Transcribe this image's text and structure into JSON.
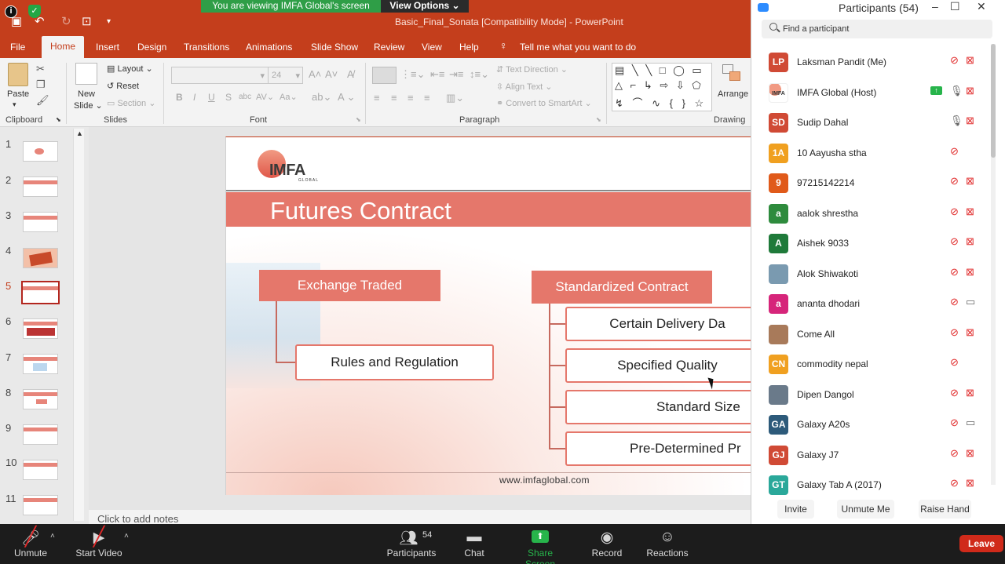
{
  "zoom": {
    "viewing_banner": "You are viewing IMFA Global's screen",
    "view_options": "View Options ⌄"
  },
  "powerpoint": {
    "doc_title": "Basic_Final_Sonata [Compatibility Mode]  -  PowerPoint",
    "tabs": [
      "File",
      "Home",
      "Insert",
      "Design",
      "Transitions",
      "Animations",
      "Slide Show",
      "Review",
      "View",
      "Help"
    ],
    "tell_me": "Tell me what you want to do",
    "ribbon": {
      "clipboard": {
        "label": "Clipboard",
        "paste": "Paste"
      },
      "slides": {
        "label": "Slides",
        "new_slide": "New",
        "new_slide2": "Slide ⌄",
        "layout": "Layout ⌄",
        "reset": "Reset",
        "section": "Section ⌄"
      },
      "font": {
        "label": "Font",
        "size": "24"
      },
      "paragraph": {
        "label": "Paragraph",
        "text_direction": "Text Direction ⌄",
        "align_text": "Align Text ⌄",
        "convert": "Convert to SmartArt ⌄"
      },
      "drawing": {
        "label": "Drawing",
        "arrange": "Arrange"
      }
    },
    "thumbnails": [
      "1",
      "2",
      "3",
      "4",
      "5",
      "6",
      "7",
      "8",
      "9",
      "10",
      "11"
    ],
    "selected_slide": "5",
    "notes_placeholder": "Click to add notes",
    "slide": {
      "logo": "IMFA",
      "logo_sub": "GLOBAL",
      "title": "Futures Contract",
      "left_header": "Exchange Traded",
      "left_items": [
        "Rules and Regulation"
      ],
      "right_header": "Standardized Contract",
      "right_items": [
        "Certain Delivery Da",
        "Specified Quality",
        "Standard Size",
        "Pre-Determined Pr"
      ],
      "footer": "www.imfaglobal.com"
    }
  },
  "participants_panel": {
    "title": "Participants (54)",
    "search_placeholder": "Find a participant",
    "participants": [
      {
        "initials": "LP",
        "name": "Laksman Pandit (Me)",
        "color": "#d04a35",
        "mic": "muted",
        "cam": "off"
      },
      {
        "initials": "IMFA",
        "name": "IMFA Global (Host)",
        "color": "#ffffff",
        "mic": "on",
        "cam": "off",
        "sharing": true
      },
      {
        "initials": "SD",
        "name": "Sudip Dahal",
        "color": "#d04a35",
        "mic": "on",
        "cam": "off"
      },
      {
        "initials": "1A",
        "name": "10 Aayusha stha",
        "color": "#f0a020",
        "mic": "muted",
        "cam": "none"
      },
      {
        "initials": "9",
        "name": "97215142214",
        "color": "#e05a1a",
        "mic": "muted",
        "cam": "off"
      },
      {
        "initials": "a",
        "name": "aalok shrestha",
        "color": "#2e8b3d",
        "mic": "muted",
        "cam": "off"
      },
      {
        "initials": "A",
        "name": "Aishek 9033",
        "color": "#1f7a3a",
        "mic": "muted",
        "cam": "off"
      },
      {
        "initials": "",
        "name": "Alok Shiwakoti",
        "color": "#7a9ab0",
        "mic": "muted",
        "cam": "off"
      },
      {
        "initials": "a",
        "name": "ananta dhodari",
        "color": "#d6257a",
        "mic": "muted",
        "cam": "on"
      },
      {
        "initials": "",
        "name": "Come All",
        "color": "#a87a5a",
        "mic": "muted",
        "cam": "off"
      },
      {
        "initials": "CN",
        "name": "commodity nepal",
        "color": "#f0a020",
        "mic": "muted",
        "cam": "none"
      },
      {
        "initials": "",
        "name": "Dipen Dangol",
        "color": "#6a7a8a",
        "mic": "muted",
        "cam": "off"
      },
      {
        "initials": "GA",
        "name": "Galaxy A20s",
        "color": "#2d5a7a",
        "mic": "muted",
        "cam": "on"
      },
      {
        "initials": "GJ",
        "name": "Galaxy J7",
        "color": "#d04a35",
        "mic": "muted",
        "cam": "off"
      },
      {
        "initials": "GT",
        "name": "Galaxy Tab A (2017)",
        "color": "#2aa89a",
        "mic": "muted",
        "cam": "off"
      }
    ],
    "buttons": {
      "invite": "Invite",
      "unmute": "Unmute Me",
      "raise_hand": "Raise Hand"
    }
  },
  "toolbar": {
    "unmute": "Unmute",
    "start_video": "Start Video",
    "participants": "Participants",
    "participants_count": "54",
    "chat": "Chat",
    "share_screen": "Share Screen",
    "record": "Record",
    "reactions": "Reactions",
    "leave": "Leave"
  },
  "colors": {
    "accent_ppt": "#c43e1c",
    "slide_coral": "#e5776b",
    "share_green": "#27b44b",
    "leave_red": "#d02a1a"
  }
}
